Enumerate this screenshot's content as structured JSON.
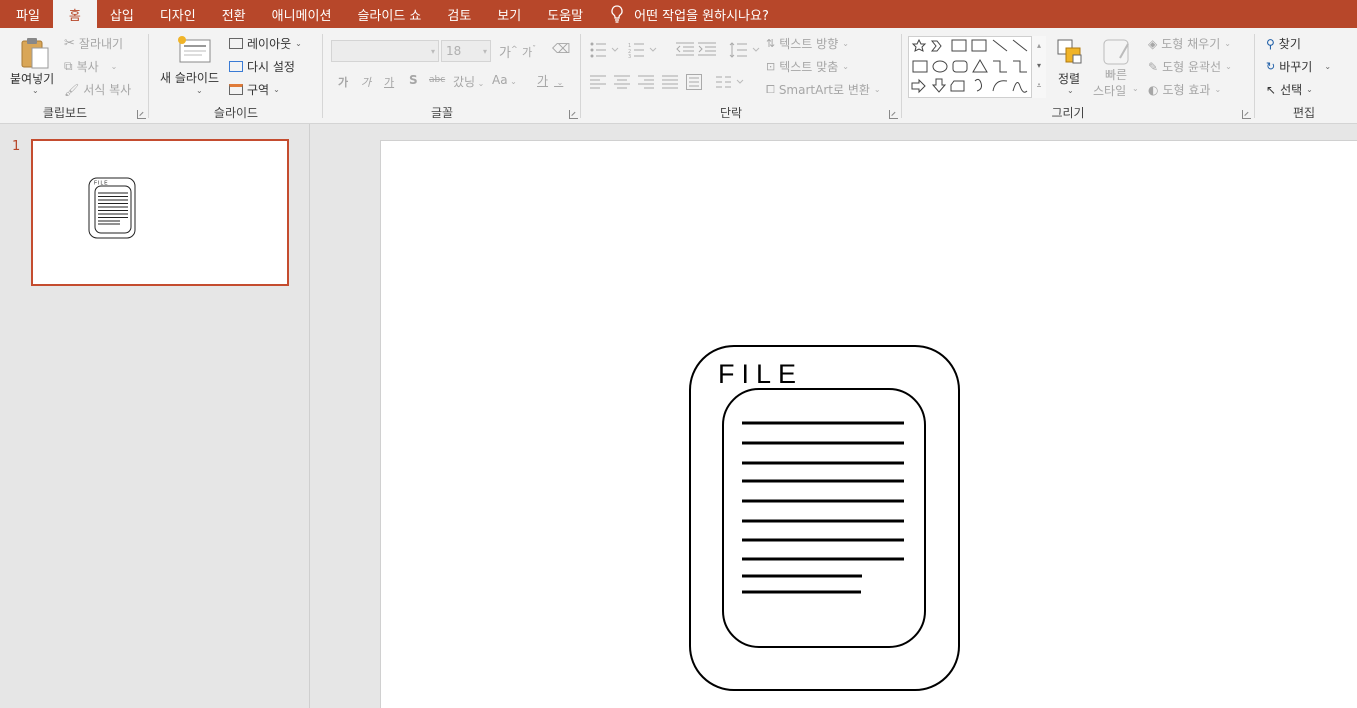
{
  "tabs": [
    "파일",
    "홈",
    "삽입",
    "디자인",
    "전환",
    "애니메이션",
    "슬라이드 쇼",
    "검토",
    "보기",
    "도움말"
  ],
  "active_tab": "홈",
  "tell_me": "어떤 작업을 원하시나요?",
  "clipboard": {
    "paste": "붙여넣기",
    "cut": "잘라내기",
    "copy": "복사",
    "format_painter": "서식 복사",
    "label": "클립보드"
  },
  "slides_group": {
    "new_slide": "새 슬라이드",
    "layout": "레이아웃",
    "reset": "다시 설정",
    "section": "구역",
    "label": "슬라이드"
  },
  "font": {
    "font_name": "",
    "font_size": "18",
    "increase": "가",
    "decrease": "가",
    "bold": "가",
    "italic": "가",
    "underline": "가",
    "shadow": "S",
    "strike": "abc",
    "spacing": "갔닝",
    "case": "Aa",
    "color": "가",
    "label": "글꼴"
  },
  "paragraph": {
    "text_direction": "텍스트 방향",
    "align_text": "텍스트 맞춤",
    "smartart": "SmartArt로 변환",
    "label": "단락"
  },
  "drawing": {
    "arrange": "정렬",
    "quick_styles_line1": "빠른",
    "quick_styles_line2": "스타일",
    "shape_fill": "도형 채우기",
    "shape_outline": "도형 윤곽선",
    "shape_effects": "도형 효과",
    "label": "그리기"
  },
  "editing": {
    "find": "찾기",
    "replace": "바꾸기",
    "select": "선택",
    "label": "편집"
  },
  "thumbnails": [
    {
      "number": "1",
      "icon": "file-document-icon",
      "text": "FILE"
    }
  ],
  "slide": {
    "file_icon_label": "FILE",
    "icon": "file-document-icon"
  },
  "colors": {
    "accent": "#b7472a",
    "ribbon_bg": "#f3f3f3",
    "workspace_bg": "#e6e6e6"
  }
}
